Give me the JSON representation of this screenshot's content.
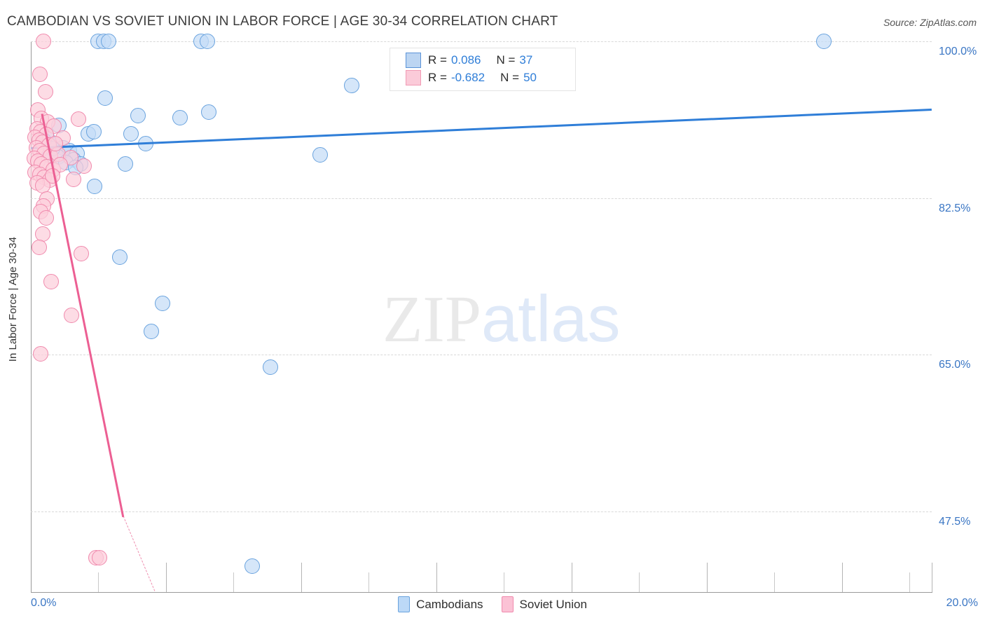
{
  "header": {
    "title": "CAMBODIAN VS SOVIET UNION IN LABOR FORCE | AGE 30-34 CORRELATION CHART",
    "source": "Source: ZipAtlas.com"
  },
  "watermark": {
    "part1": "ZIP",
    "part2": "atlas"
  },
  "legend": {
    "blue": {
      "r_key": "R =",
      "r_value": "0.086",
      "n_key": "N =",
      "n_value": "37"
    },
    "pink": {
      "r_key": "R =",
      "r_value": "-0.682",
      "n_key": "N =",
      "n_value": "50"
    }
  },
  "bottom_legend": [
    {
      "label": "Cambodians",
      "color": "#bcd9f7"
    },
    {
      "label": "Soviet Union",
      "color": "#fbc2d5"
    }
  ],
  "chart_data": {
    "type": "scatter",
    "title": "CAMBODIAN VS SOVIET UNION IN LABOR FORCE | AGE 30-34 CORRELATION CHART",
    "xlabel": "",
    "ylabel": "In Labor Force | Age 30-34",
    "xlim": [
      0.0,
      20.0
    ],
    "ylim": [
      38.5,
      100.0
    ],
    "x_tick_labels": [
      "0.0%",
      "20.0%"
    ],
    "y_tick_labels": [
      "100.0%",
      "82.5%",
      "65.0%",
      "47.5%"
    ],
    "y_ticks": [
      100.0,
      82.5,
      65.0,
      47.5
    ],
    "grid": true,
    "legend_position": "top-center",
    "series": [
      {
        "name": "Cambodians",
        "color": "#bcd9f7",
        "border_color": "#6aa3de",
        "r": 0.086,
        "n": 37,
        "trend": {
          "x0": 0.0,
          "y0": 88.2,
          "x1": 20.0,
          "y1": 92.5,
          "style": "solid"
        },
        "points": [
          [
            1.49,
            100.0
          ],
          [
            1.62,
            100.0
          ],
          [
            1.72,
            100.0
          ],
          [
            3.78,
            100.0
          ],
          [
            3.92,
            100.0
          ],
          [
            17.6,
            100.0
          ],
          [
            7.12,
            95.1
          ],
          [
            1.65,
            93.7
          ],
          [
            2.38,
            91.7
          ],
          [
            3.31,
            91.5
          ],
          [
            3.95,
            92.1
          ],
          [
            0.62,
            90.6
          ],
          [
            1.27,
            89.7
          ],
          [
            1.4,
            89.9
          ],
          [
            2.22,
            89.7
          ],
          [
            2.55,
            88.6
          ],
          [
            0.35,
            89.3
          ],
          [
            0.52,
            88.5
          ],
          [
            0.72,
            88.1
          ],
          [
            0.86,
            87.8
          ],
          [
            1.02,
            87.5
          ],
          [
            0.42,
            87.3
          ],
          [
            0.6,
            87.1
          ],
          [
            0.95,
            86.8
          ],
          [
            1.1,
            86.3
          ],
          [
            6.42,
            87.3
          ],
          [
            0.3,
            88.9
          ],
          [
            0.48,
            88.0
          ],
          [
            0.78,
            86.5
          ],
          [
            1.0,
            85.9
          ],
          [
            2.1,
            86.3
          ],
          [
            1.42,
            83.8
          ],
          [
            1.98,
            75.9
          ],
          [
            2.92,
            70.7
          ],
          [
            2.68,
            67.6
          ],
          [
            5.32,
            63.6
          ],
          [
            4.92,
            41.4
          ]
        ]
      },
      {
        "name": "Soviet Union",
        "color": "#fbc2d5",
        "border_color": "#f08aad",
        "r": -0.682,
        "n": 50,
        "trend": {
          "x0": 0.25,
          "y0": 92.0,
          "x1": 2.05,
          "y1": 47.0,
          "style": "solid"
        },
        "trend_extension": {
          "x0": 2.05,
          "y0": 47.0,
          "x1": 2.75,
          "y1": 38.6,
          "style": "dashed"
        },
        "points": [
          [
            0.28,
            100.0
          ],
          [
            0.2,
            96.3
          ],
          [
            0.32,
            94.4
          ],
          [
            0.16,
            92.3
          ],
          [
            0.24,
            91.4
          ],
          [
            0.38,
            91.0
          ],
          [
            0.52,
            90.5
          ],
          [
            0.14,
            90.2
          ],
          [
            0.22,
            89.9
          ],
          [
            0.34,
            89.6
          ],
          [
            0.1,
            89.3
          ],
          [
            0.18,
            89.0
          ],
          [
            0.26,
            88.7
          ],
          [
            0.4,
            88.4
          ],
          [
            0.12,
            88.1
          ],
          [
            0.2,
            87.8
          ],
          [
            0.3,
            87.5
          ],
          [
            0.44,
            87.2
          ],
          [
            0.08,
            86.9
          ],
          [
            0.16,
            86.6
          ],
          [
            0.24,
            86.3
          ],
          [
            0.36,
            86.0
          ],
          [
            0.5,
            85.7
          ],
          [
            0.1,
            85.4
          ],
          [
            0.2,
            85.1
          ],
          [
            0.3,
            84.8
          ],
          [
            0.42,
            84.5
          ],
          [
            0.14,
            84.2
          ],
          [
            0.26,
            83.9
          ],
          [
            0.6,
            87.4
          ],
          [
            1.05,
            91.3
          ],
          [
            0.72,
            89.2
          ],
          [
            0.88,
            87.0
          ],
          [
            1.18,
            86.1
          ],
          [
            0.95,
            84.6
          ],
          [
            0.36,
            82.4
          ],
          [
            0.28,
            81.6
          ],
          [
            0.22,
            81.0
          ],
          [
            0.34,
            80.3
          ],
          [
            0.26,
            78.5
          ],
          [
            0.18,
            77.0
          ],
          [
            1.12,
            76.3
          ],
          [
            0.45,
            73.2
          ],
          [
            0.9,
            69.4
          ],
          [
            0.22,
            65.1
          ],
          [
            0.55,
            88.6
          ],
          [
            0.66,
            86.2
          ],
          [
            0.48,
            85.0
          ],
          [
            1.45,
            42.3
          ],
          [
            1.52,
            42.3
          ]
        ]
      }
    ]
  }
}
